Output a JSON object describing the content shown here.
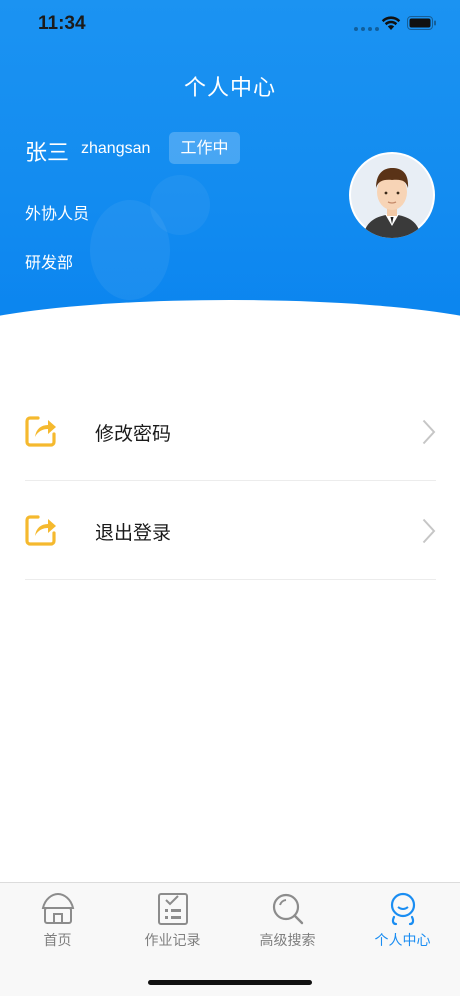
{
  "status_bar": {
    "time": "11:34"
  },
  "header": {
    "title": "个人中心",
    "user_name": "张三",
    "account": "zhangsan",
    "status_badge": "工作中",
    "role": "外协人员",
    "department": "研发部"
  },
  "menu": [
    {
      "label": "修改密码",
      "icon": "edit-share-icon"
    },
    {
      "label": "退出登录",
      "icon": "edit-share-icon"
    }
  ],
  "tabbar": {
    "items": [
      {
        "label": "首页",
        "icon": "home-icon",
        "active": false
      },
      {
        "label": "作业记录",
        "icon": "checklist-icon",
        "active": false
      },
      {
        "label": "高级搜索",
        "icon": "search-icon",
        "active": false
      },
      {
        "label": "个人中心",
        "icon": "profile-icon",
        "active": true
      }
    ]
  },
  "colors": {
    "header_blue": "#138cf0",
    "accent": "#1a8df2",
    "menu_icon": "#f5b92e",
    "tab_inactive": "#7f7f7f"
  }
}
